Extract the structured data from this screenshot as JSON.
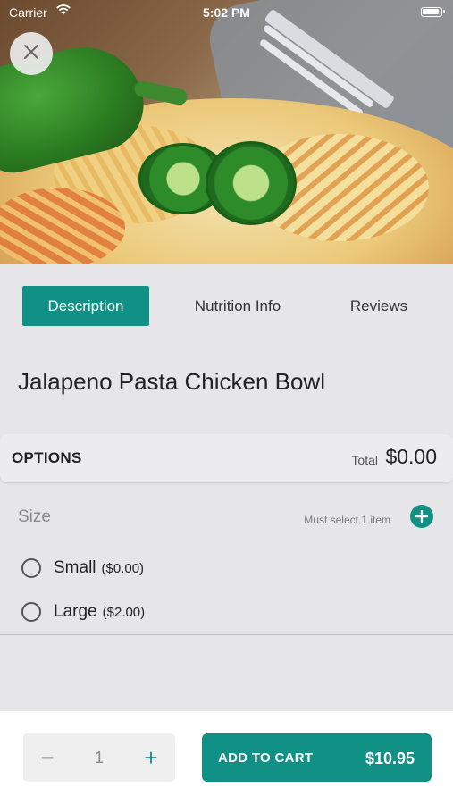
{
  "status_bar": {
    "carrier": "Carrier",
    "time": "5:02 PM"
  },
  "colors": {
    "accent": "#119185",
    "background": "#e6e6e8"
  },
  "icons": {
    "close": "close-icon",
    "wifi": "wifi-icon",
    "battery": "battery-icon",
    "add": "plus-icon",
    "minus": "minus-icon"
  },
  "tabs": [
    {
      "label": "Description",
      "active": true
    },
    {
      "label": "Nutrition Info",
      "active": false
    },
    {
      "label": "Reviews",
      "active": false
    }
  ],
  "item": {
    "title": "Jalapeno Pasta Chicken Bowl"
  },
  "options": {
    "header": "OPTIONS",
    "total_label": "Total",
    "total_value": "$0.00",
    "groups": [
      {
        "name": "Size",
        "requirement": "Must select 1 item",
        "choices": [
          {
            "name": "Small",
            "price": "($0.00)",
            "selected": false
          },
          {
            "name": "Large",
            "price": "($2.00)",
            "selected": false
          }
        ]
      }
    ]
  },
  "cart": {
    "quantity": "1",
    "minus": "−",
    "plus": "+",
    "add_label": "ADD TO CART",
    "price": "$10.95"
  }
}
